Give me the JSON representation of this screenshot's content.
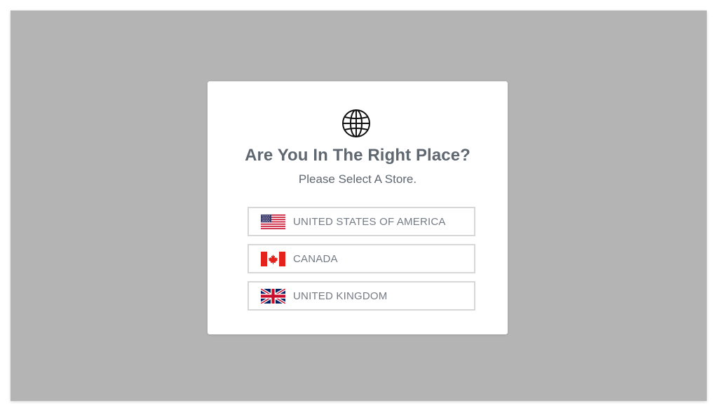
{
  "dialog": {
    "title": "Are You In The Right Place?",
    "subtitle": "Please Select A Store.",
    "icon": "globe-icon"
  },
  "stores": [
    {
      "label": "UNITED STATES OF AMERICA",
      "flag_icon": "usa-flag-icon"
    },
    {
      "label": "CANADA",
      "flag_icon": "canada-flag-icon"
    },
    {
      "label": "UNITED KINGDOM",
      "flag_icon": "uk-flag-icon"
    }
  ],
  "colors": {
    "backdrop": "#b4b4b4",
    "modal_bg": "#ffffff",
    "text": "#5f6770",
    "button_text": "#747b84",
    "button_border": "#d7d7d7"
  }
}
